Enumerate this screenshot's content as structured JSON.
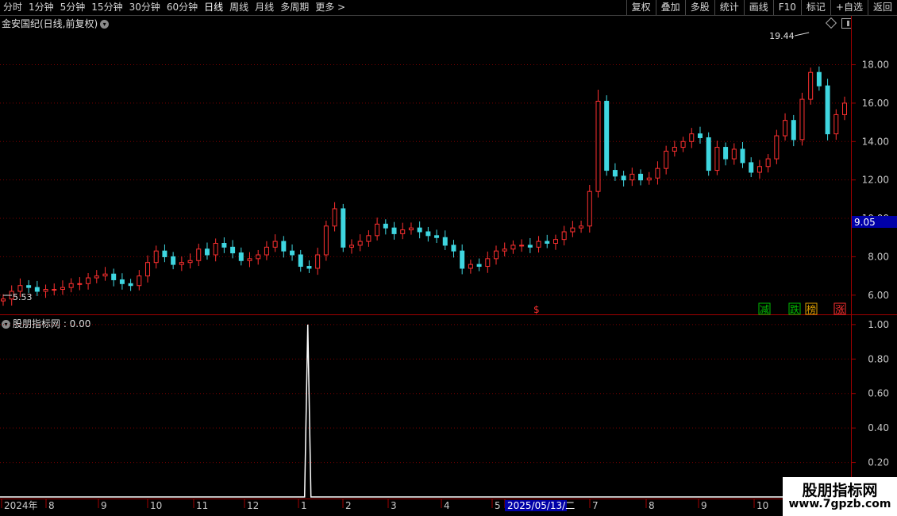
{
  "toolbar": {
    "left": [
      "分时",
      "1分钟",
      "5分钟",
      "15分钟",
      "30分钟",
      "60分钟",
      "日线",
      "周线",
      "月线",
      "多周期",
      "更多 >"
    ],
    "active": "日线",
    "right": [
      "复权",
      "叠加",
      "多股",
      "统计",
      "画线",
      "F10",
      "标记",
      "+自选",
      "返回"
    ]
  },
  "main": {
    "title": "金安国纪(日线,前复权)",
    "high_label": "19.44",
    "low_label": "5.53",
    "current_price": "9.05",
    "signals": [
      "$",
      "减",
      "跌",
      "榜",
      "涨"
    ]
  },
  "indicator": {
    "title": "股朋指标网 : 0.00"
  },
  "watermark": {
    "line1": "股朋指标网",
    "line2": "www.7gpzb.com"
  },
  "colors": {
    "up": "#ff3030",
    "down": "#3fd6e0",
    "grid": "#7a0000",
    "axis": "#a00000",
    "price_label_bg": "#0000a8"
  },
  "chart_data": [
    {
      "type": "candlestick",
      "title": "金安国纪(日线,前复权)",
      "y_ticks": [
        "6.00",
        "8.00",
        "10.00",
        "12.00",
        "14.00",
        "16.00",
        "18.00"
      ],
      "ylim": [
        5.0,
        19.8
      ],
      "x_ticks": [
        "2024年",
        "8",
        "9",
        "10",
        "11",
        "12",
        "1",
        "2",
        "3",
        "4",
        "5",
        "2025/05/13/二",
        "7",
        "8",
        "9",
        "10"
      ],
      "series": [
        {
          "name": "close_approx",
          "values": [
            5.8,
            6.2,
            6.5,
            6.4,
            6.2,
            6.3,
            6.3,
            6.4,
            6.6,
            6.6,
            6.9,
            7.0,
            7.1,
            6.8,
            6.6,
            6.5,
            7.0,
            7.7,
            8.3,
            8.0,
            7.6,
            7.7,
            7.8,
            8.4,
            8.1,
            8.7,
            8.5,
            8.2,
            7.8,
            7.9,
            8.1,
            8.5,
            8.8,
            8.3,
            8.1,
            7.5,
            7.4,
            8.1,
            9.6,
            10.5,
            8.5,
            8.6,
            8.8,
            9.1,
            9.7,
            9.5,
            9.2,
            9.4,
            9.5,
            9.3,
            9.1,
            9.0,
            8.6,
            8.3,
            7.4,
            7.6,
            7.5,
            7.9,
            8.3,
            8.4,
            8.6,
            8.6,
            8.5,
            8.8,
            8.7,
            8.9,
            9.3,
            9.5,
            9.6,
            11.4,
            16.1,
            12.5,
            12.2,
            12.0,
            12.3,
            12.0,
            12.1,
            12.6,
            13.5,
            13.7,
            14.0,
            14.4,
            14.2,
            12.5,
            13.7,
            13.1,
            13.6,
            12.9,
            12.4,
            12.7,
            13.1,
            14.3,
            15.1,
            14.1,
            16.2,
            17.6,
            16.9,
            14.4,
            15.4,
            16.0
          ]
        }
      ]
    },
    {
      "type": "line",
      "title": "股朋指标网 : 0.00",
      "y_ticks": [
        "0.20",
        "0.40",
        "0.60",
        "0.80",
        "1.00"
      ],
      "ylim": [
        0,
        1.05
      ],
      "series": [
        {
          "name": "股朋指标网",
          "spike_index_fraction": 0.362,
          "spike_value": 1.0,
          "baseline": 0.0
        }
      ]
    }
  ]
}
